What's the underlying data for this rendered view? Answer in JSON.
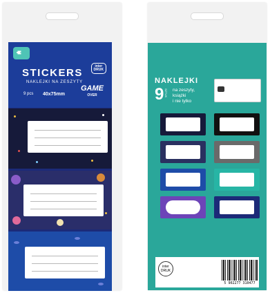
{
  "front": {
    "title": "STICKERS",
    "subtitle": "NAKLEJKI NA ZESZYTY",
    "pieces": "9 pcs",
    "size": "40x75mm",
    "brand_top": "inter",
    "brand_bottom": "DRUK",
    "game_top": "GAME",
    "game_bottom": "OVER"
  },
  "back": {
    "title": "NAKLEJKI",
    "count": "9",
    "count_unit": "SZTUK",
    "desc_line1": "na zeszyty,",
    "desc_line2": "książki",
    "desc_line3": "i nie tylko",
    "logo_top": "inter",
    "logo_bottom": "DRUK",
    "barcode_number": "5 902277 310477"
  },
  "colors": {
    "front_header": "#1c3d9a",
    "back_card": "#2aa79a"
  }
}
